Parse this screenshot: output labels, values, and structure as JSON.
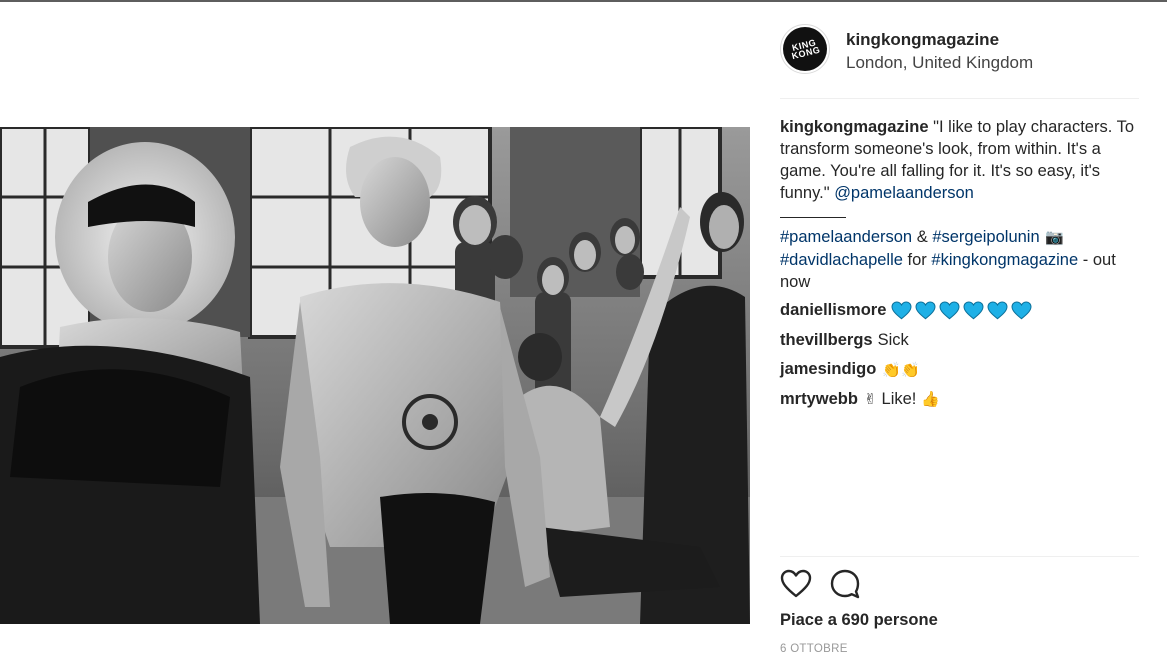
{
  "post": {
    "username": "kingkongmagazine",
    "location": "London, United Kingdom",
    "avatar_text": "KING KONG",
    "photo_desc": "black-and-white editorial photo"
  },
  "caption": {
    "username": "kingkongmagazine",
    "quote": "\"I like to play characters. To transform someone's look, from within. It's a game. You're all falling for it. It's so easy, it's funny.\"",
    "mention": "@pamelaanderson",
    "rule": "________",
    "tag1": "#pamelaanderson",
    "amp": "&",
    "tag2": "#sergeipolunin",
    "camera_emoji": "📷",
    "tag3": "#davidlachapelle",
    "for_text": "for",
    "tag4": "#kingkongmagazine",
    "tail": "- out now"
  },
  "comments": [
    {
      "user": "daniellismore",
      "text": "",
      "hearts": 6,
      "heart_color": "#1fb0e6"
    },
    {
      "user": "thevillbergs",
      "text": "Sick"
    },
    {
      "user": "jamesindigo",
      "text": "👏👏"
    },
    {
      "user": "mrtywebb",
      "text_a": "✌",
      "text_b": "Like!",
      "text_c": "👍"
    }
  ],
  "actions": {
    "like_icon": "heart-icon",
    "comment_icon": "comment-icon"
  },
  "likes_text": "Piace a 690 persone",
  "date_text": "6 OTTOBRE"
}
